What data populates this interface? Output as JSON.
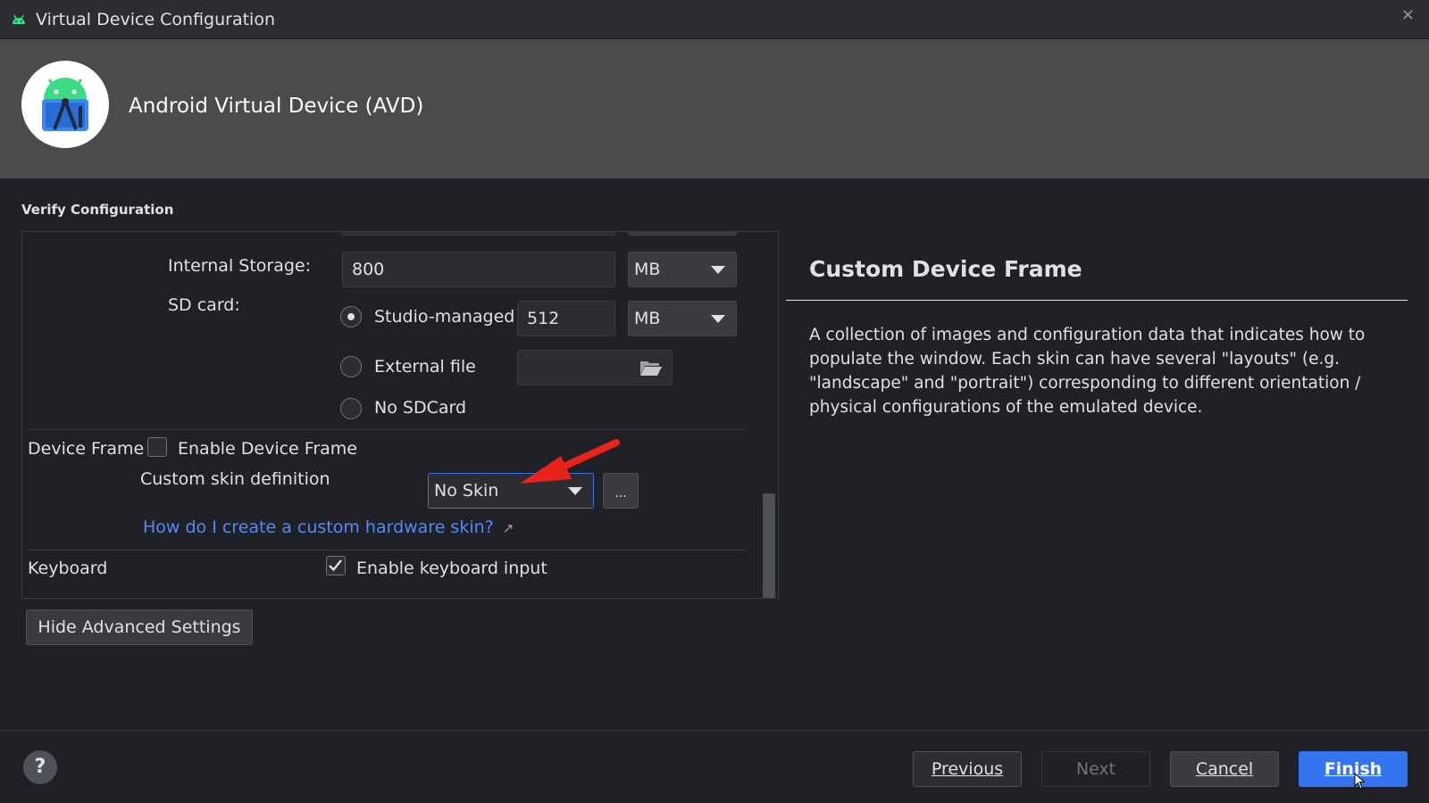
{
  "window": {
    "title": "Virtual Device Configuration",
    "close_glyph": "×"
  },
  "header": {
    "title": "Android Virtual Device (AVD)"
  },
  "section_title": "Verify Configuration",
  "settings": {
    "internal_storage": {
      "label": "Internal Storage:",
      "value": "800",
      "unit": "MB"
    },
    "sd_card": {
      "label": "SD card:",
      "options": [
        {
          "label": "Studio-managed",
          "selected": true,
          "size": "512",
          "unit": "MB"
        },
        {
          "label": "External file",
          "selected": false
        },
        {
          "label": "No SDCard",
          "selected": false
        }
      ]
    },
    "device_frame": {
      "label": "Device Frame",
      "checkbox_label": "Enable Device Frame",
      "checked": false,
      "skin_label": "Custom skin definition",
      "skin_value": "No Skin",
      "browse_label": "...",
      "help_link": "How do I create a custom hardware skin?",
      "link_icon": "↗"
    },
    "keyboard": {
      "label": "Keyboard",
      "checkbox_label": "Enable keyboard input",
      "checked": true
    }
  },
  "advanced_button": "Hide Advanced Settings",
  "help_panel": {
    "title": "Custom Device Frame",
    "body": "A collection of images and configuration data that indicates how to populate the window. Each skin can have several \"layouts\" (e.g. \"landscape\" and \"portrait\") corresponding to different orientation / physical configurations of the emulated device."
  },
  "footer": {
    "help_glyph": "?",
    "buttons": {
      "previous": "Previous",
      "next": "Next",
      "cancel": "Cancel",
      "finish": "Finish"
    }
  },
  "colors": {
    "accent": "#3574f0",
    "link": "#548af7",
    "annotation_arrow": "#e8231c"
  }
}
